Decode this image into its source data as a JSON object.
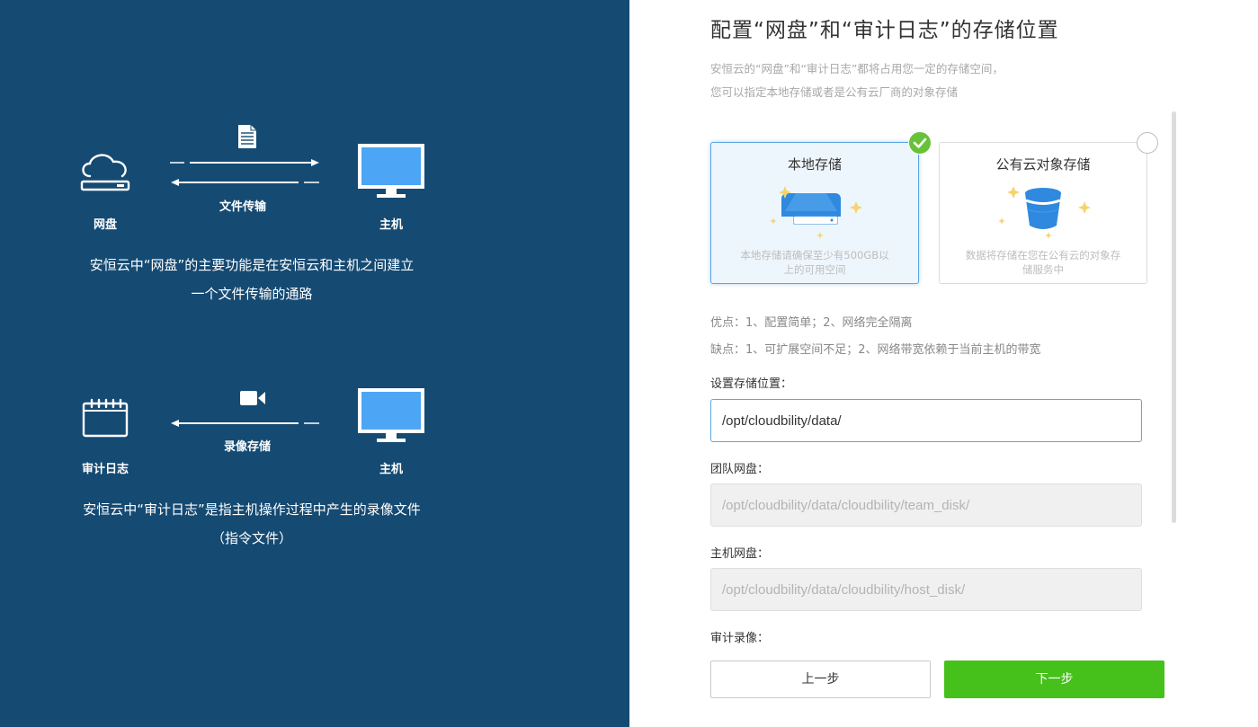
{
  "left": {
    "section1": {
      "source_label": "网盘",
      "transfer_label": "文件传输",
      "target_label": "主机",
      "description_line1": "安恒云中“网盘”的主要功能是在安恒云和主机之间建立",
      "description_line2": "一个文件传输的通路"
    },
    "section2": {
      "source_label": "审计日志",
      "transfer_label": "录像存储",
      "target_label": "主机",
      "description_line1": "安恒云中“审计日志”是指主机操作过程中产生的录像文件",
      "description_line2": "（指令文件）"
    },
    "icon_color": "#4da6f5"
  },
  "right": {
    "title": "配置“网盘”和“审计日志”的存储位置",
    "subtitle_line1": "安恒云的“网盘”和“审计日志”都将占用您一定的存储空间，",
    "subtitle_line2": "您可以指定本地存储或者是公有云厂商的对象存储",
    "options": [
      {
        "title": "本地存储",
        "description": "本地存储请确保至少有500GB以上的可用空间",
        "selected": true,
        "icon": "hard-drive-icon"
      },
      {
        "title": "公有云对象存储",
        "description": "数据将存储在您在公有云的对象存储服务中",
        "selected": false,
        "icon": "bucket-icon"
      }
    ],
    "pros": "优点：1、配置简单；2、网络完全隔离",
    "cons": "缺点：1、可扩展空间不足；2、网络带宽依赖于当前主机的带宽",
    "storage_location": {
      "label": "设置存储位置：",
      "value": "/opt/cloudbility/data/"
    },
    "team_disk": {
      "label": "团队网盘：",
      "value": "/opt/cloudbility/data/cloudbility/team_disk/"
    },
    "host_disk": {
      "label": "主机网盘：",
      "value": "/opt/cloudbility/data/cloudbility/host_disk/"
    },
    "audit_recording": {
      "label": "审计录像："
    },
    "prev_button": "上一步",
    "next_button": "下一步",
    "accent_color": "#46c11b",
    "selected_border_color": "#5aa7e6"
  }
}
